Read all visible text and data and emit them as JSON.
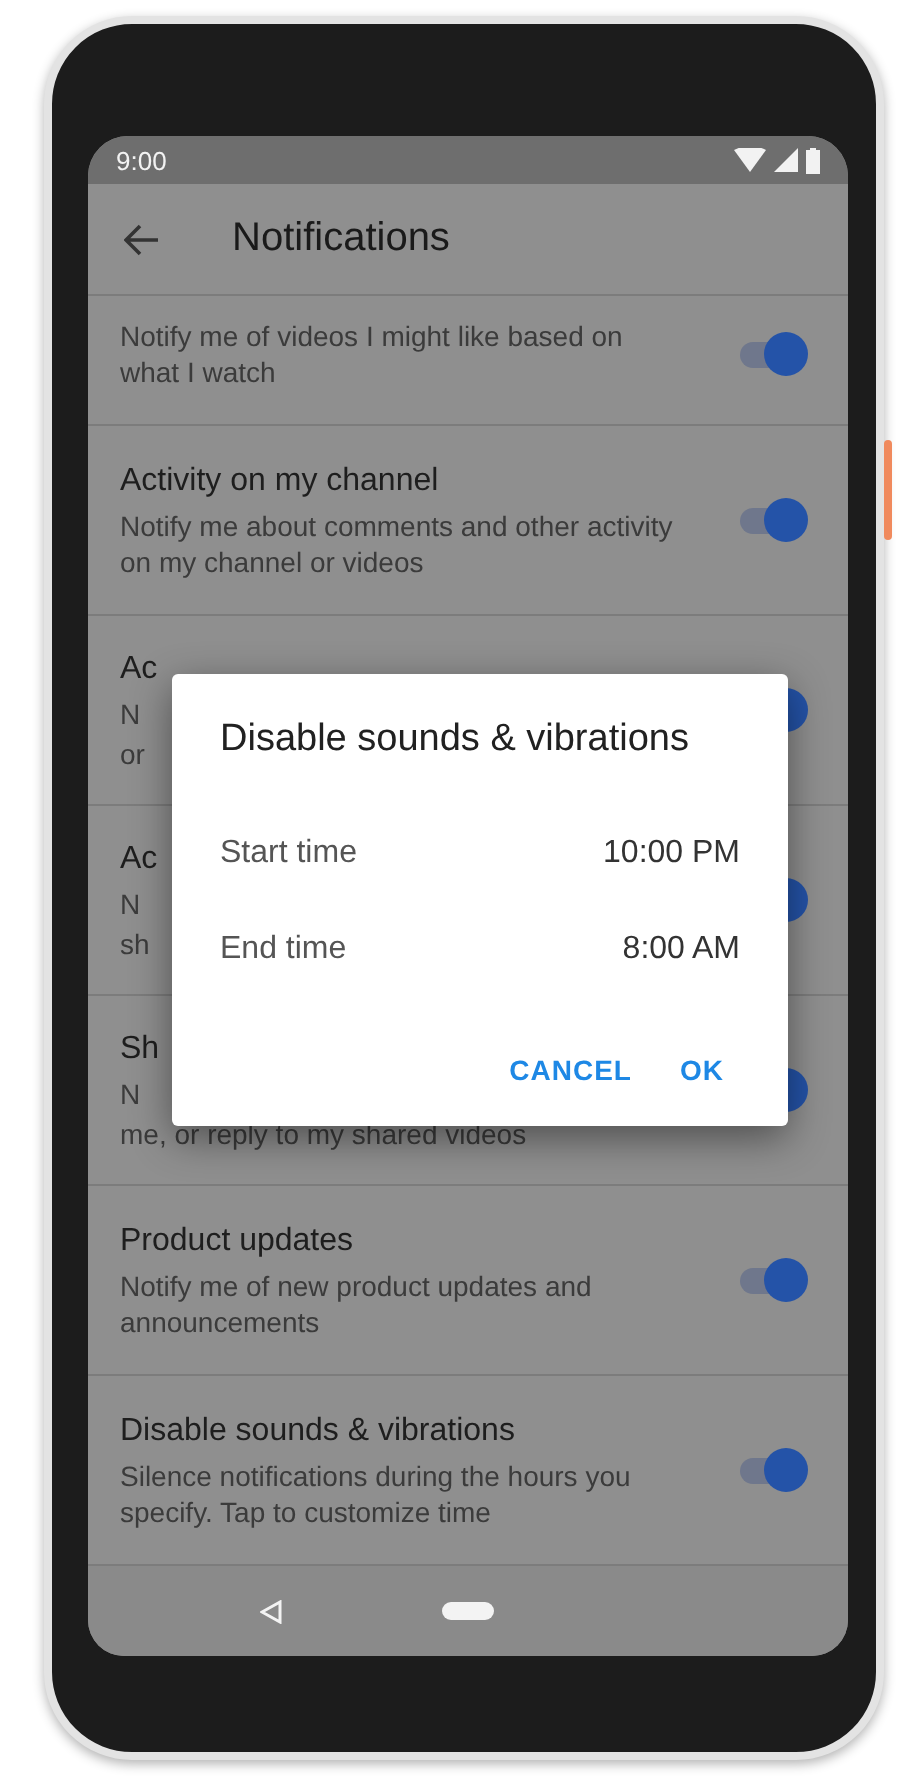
{
  "status_bar": {
    "time": "9:00"
  },
  "toolbar": {
    "title": "Notifications"
  },
  "settings": [
    {
      "description": "Notify me of videos I might like based on what I watch",
      "on": true
    },
    {
      "title": "Activity on my channel",
      "description": "Notify me about comments and other activity on my channel or videos",
      "on": true
    },
    {
      "title": "Ac",
      "description_fragments": [
        "N",
        "or"
      ],
      "on": true
    },
    {
      "title": "Ac",
      "description_fragments": [
        "N",
        "sh"
      ],
      "on": true
    },
    {
      "title": "Sh",
      "description_fragments": [
        "N",
        "me, or reply to my shared videos"
      ],
      "on": true
    },
    {
      "title": "Product updates",
      "description": "Notify me of new product updates and announcements",
      "on": true
    },
    {
      "title": "Disable sounds & vibrations",
      "description": "Silence notifications during the hours you specify.  Tap to customize time",
      "on": true
    }
  ],
  "dialog": {
    "title": "Disable sounds & vibrations",
    "rows": [
      {
        "label": "Start time",
        "value": "10:00 PM"
      },
      {
        "label": "End time",
        "value": "8:00 AM"
      }
    ],
    "buttons": [
      "CANCEL",
      "OK"
    ]
  }
}
